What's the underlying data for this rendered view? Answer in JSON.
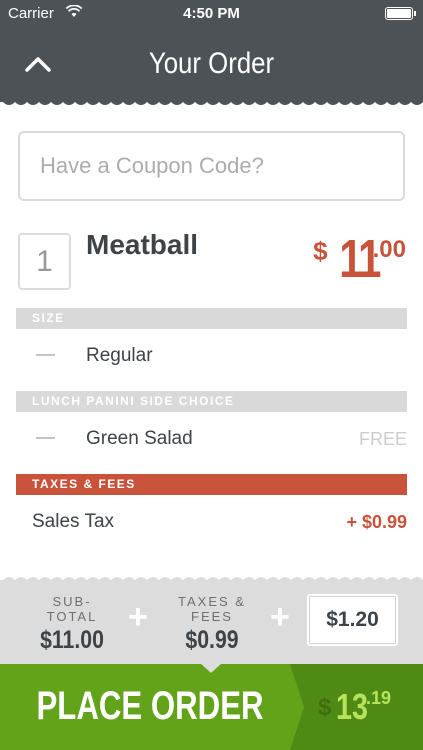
{
  "status_bar": {
    "carrier": "Carrier",
    "time": "4:50 PM",
    "wifi_icon": "wifi-icon",
    "battery_icon": "battery-icon"
  },
  "header": {
    "title": "Your Order",
    "collapse_icon": "chevron-up-icon"
  },
  "coupon": {
    "placeholder": "Have a Coupon Code?"
  },
  "item": {
    "quantity": "1",
    "name": "Meatball",
    "price_currency": "$",
    "price_whole": "11",
    "price_cents": ".00"
  },
  "sections": {
    "size": {
      "title": "SIZE",
      "option": "Regular"
    },
    "side": {
      "title": "LUNCH PANINI SIDE CHOICE",
      "option": "Green Salad",
      "price": "FREE"
    },
    "taxes": {
      "title": "TAXES & FEES",
      "label": "Sales Tax",
      "amount": "+ $0.99"
    }
  },
  "totals": {
    "subtotal_label": "SUB-TOTAL",
    "subtotal_value": "$11.00",
    "taxes_label": "TAXES & FEES",
    "taxes_value": "$0.99",
    "plus_sign": "+",
    "tip_value": "$1.20"
  },
  "footer": {
    "place_order_label": "PLACE ORDER",
    "total_currency": "$",
    "total_whole": "13",
    "total_cents": ".19"
  },
  "colors": {
    "header_bg": "#4d5257",
    "accent_red": "#c8533a",
    "place_order_green": "#63a31a",
    "total_green_dark": "#4f8a15"
  }
}
